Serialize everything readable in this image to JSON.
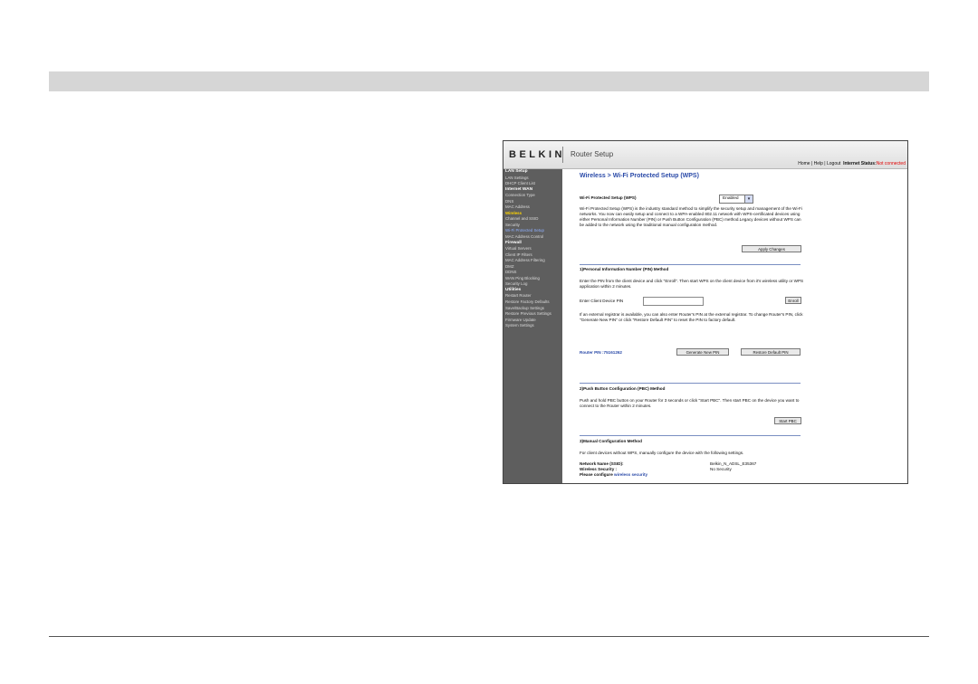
{
  "header": {
    "logo": "BELKIN",
    "product": "Router Setup",
    "links": {
      "home": "Home",
      "help": "Help",
      "logout": "Logout",
      "sep": " | "
    },
    "status_label": "Internet Status:",
    "status_value": "Not connected"
  },
  "sidebar": {
    "items": [
      {
        "label": "LAN Setup",
        "kind": "head"
      },
      {
        "label": "LAN Settings",
        "kind": "item"
      },
      {
        "label": "DHCP Client List",
        "kind": "item"
      },
      {
        "label": "Internet WAN",
        "kind": "head"
      },
      {
        "label": "Connection Type",
        "kind": "item"
      },
      {
        "label": "DNS",
        "kind": "item"
      },
      {
        "label": "MAC Address",
        "kind": "item"
      },
      {
        "label": "Wireless",
        "kind": "active"
      },
      {
        "label": "Channel and SSID",
        "kind": "item"
      },
      {
        "label": "Security",
        "kind": "item"
      },
      {
        "label": "Wi-Fi Protected Setup",
        "kind": "selected"
      },
      {
        "label": "MAC Address Control",
        "kind": "item"
      },
      {
        "label": "Firewall",
        "kind": "head"
      },
      {
        "label": "Virtual Servers",
        "kind": "item"
      },
      {
        "label": "Client IP Filters",
        "kind": "item"
      },
      {
        "label": "MAC Address Filtering",
        "kind": "item"
      },
      {
        "label": "DMZ",
        "kind": "item"
      },
      {
        "label": "DDNS",
        "kind": "item"
      },
      {
        "label": "WAN Ping Blocking",
        "kind": "item"
      },
      {
        "label": "Security Log",
        "kind": "item"
      },
      {
        "label": "Utilities",
        "kind": "head"
      },
      {
        "label": "Restart Router",
        "kind": "item"
      },
      {
        "label": "Restore Factory Defaults",
        "kind": "item"
      },
      {
        "label": "Save/Backup Settings",
        "kind": "item"
      },
      {
        "label": "Restore Previous Settings",
        "kind": "item"
      },
      {
        "label": "Firmware Update",
        "kind": "item"
      },
      {
        "label": "System Settings",
        "kind": "item"
      }
    ]
  },
  "main": {
    "title": "Wireless  > Wi-Fi Protected Setup (WPS)",
    "wps_label": "Wi-Fi Protected Setup (WPS)",
    "wps_value": "Enabled",
    "wps_desc": "Wi-Fi Protected Setup (WPS) is the industry standard method to simplify the security setup and management of the Wi-Fi networks. You now can easily setup and connect to a WPA-enabled 802.11 network with WPS-certificated devices using either Personal Information Number (PIN) or Push Button Configuration (PBC) method.Legacy devices without WPS can be added to the network using the traditional manual configuration method.",
    "apply_button": "Apply Changes",
    "pin_section_title": "1)Personal Information Number (PIN) Method",
    "pin_desc": "Enter the PIN from the client device and click \"Enroll\". Then start WPS on the client device from it's wireless utility or WPS application within 2 minutes.",
    "client_pin_label": "Enter Client Device PIN",
    "client_pin_value": "",
    "enroll_button": "Enroll",
    "registrar_desc": "If an external registrar is available, you can also enter Router's PIN at the external registrar. To change Router's PIN, click \"Generate New PIN\" or click \"Restore Default PIN\" to reset the PIN to factory default.",
    "router_pin_label": "Router PIN :",
    "router_pin_value": "75161262",
    "generate_button": "Generate New PIN",
    "restore_button": "Restore Default PIN",
    "pbc_section_title": "2)Push Button Configuration (PBC) Method",
    "pbc_desc": "Push and hold PBC button on your Router for 3 seconds or click \"Start PBC\". Then start PBC on the device you want to connect to the Router within 2 minutes.",
    "start_pbc_button": "Start PBC",
    "manual_section_title": "3)Manual Configuration Method",
    "manual_desc": "For client devices without WPS, manually configure the device with the following settings.",
    "ssid_label": "Network Name (SSID):",
    "ssid_value": "Belkin_N_ADSL_E35367",
    "security_label": "Wireless Security :",
    "security_value": "No Security",
    "configure_prefix": "Please configure ",
    "configure_link": "wireless security"
  }
}
